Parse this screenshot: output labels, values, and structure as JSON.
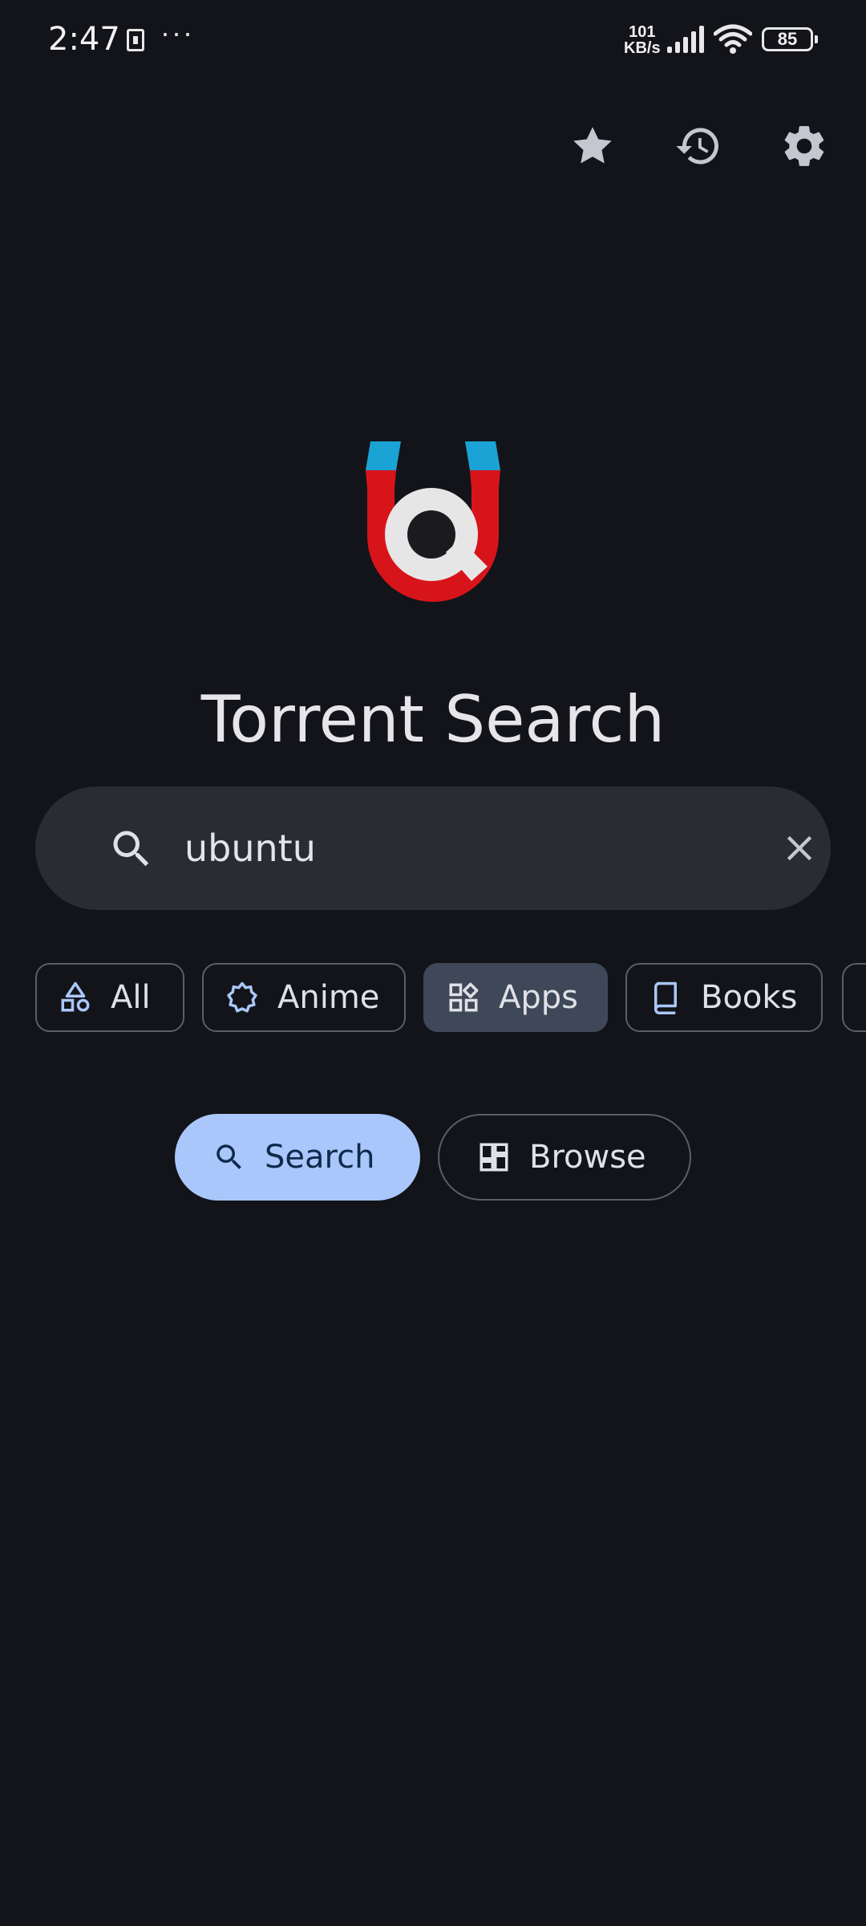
{
  "status_bar": {
    "time": "2:47",
    "more": "···",
    "net_speed_value": "101",
    "net_speed_unit": "KB/s",
    "battery": "85"
  },
  "toolbar": {
    "icons": [
      "star-icon",
      "history-icon",
      "gear-icon"
    ]
  },
  "app": {
    "title": "Torrent Search",
    "logo_colors": {
      "magnet": "#d8141b",
      "tips": "#1aa3d4",
      "lens": "#e6e6e6"
    }
  },
  "search": {
    "value": "ubuntu",
    "placeholder": ""
  },
  "categories": [
    {
      "label": "All",
      "icon": "shapes-icon",
      "selected": false
    },
    {
      "label": "Anime",
      "icon": "anime-badge-icon",
      "selected": false
    },
    {
      "label": "Apps",
      "icon": "apps-icon",
      "selected": true
    },
    {
      "label": "Books",
      "icon": "book-icon",
      "selected": false
    },
    {
      "label": "",
      "icon": "more-category-icon",
      "selected": false
    }
  ],
  "actions": {
    "search_label": "Search",
    "browse_label": "Browse"
  },
  "colors": {
    "background": "#131419",
    "accent": "#a9c7fa",
    "chip_selected": "#3e4858",
    "chip_icon": "#a9c7fa"
  }
}
